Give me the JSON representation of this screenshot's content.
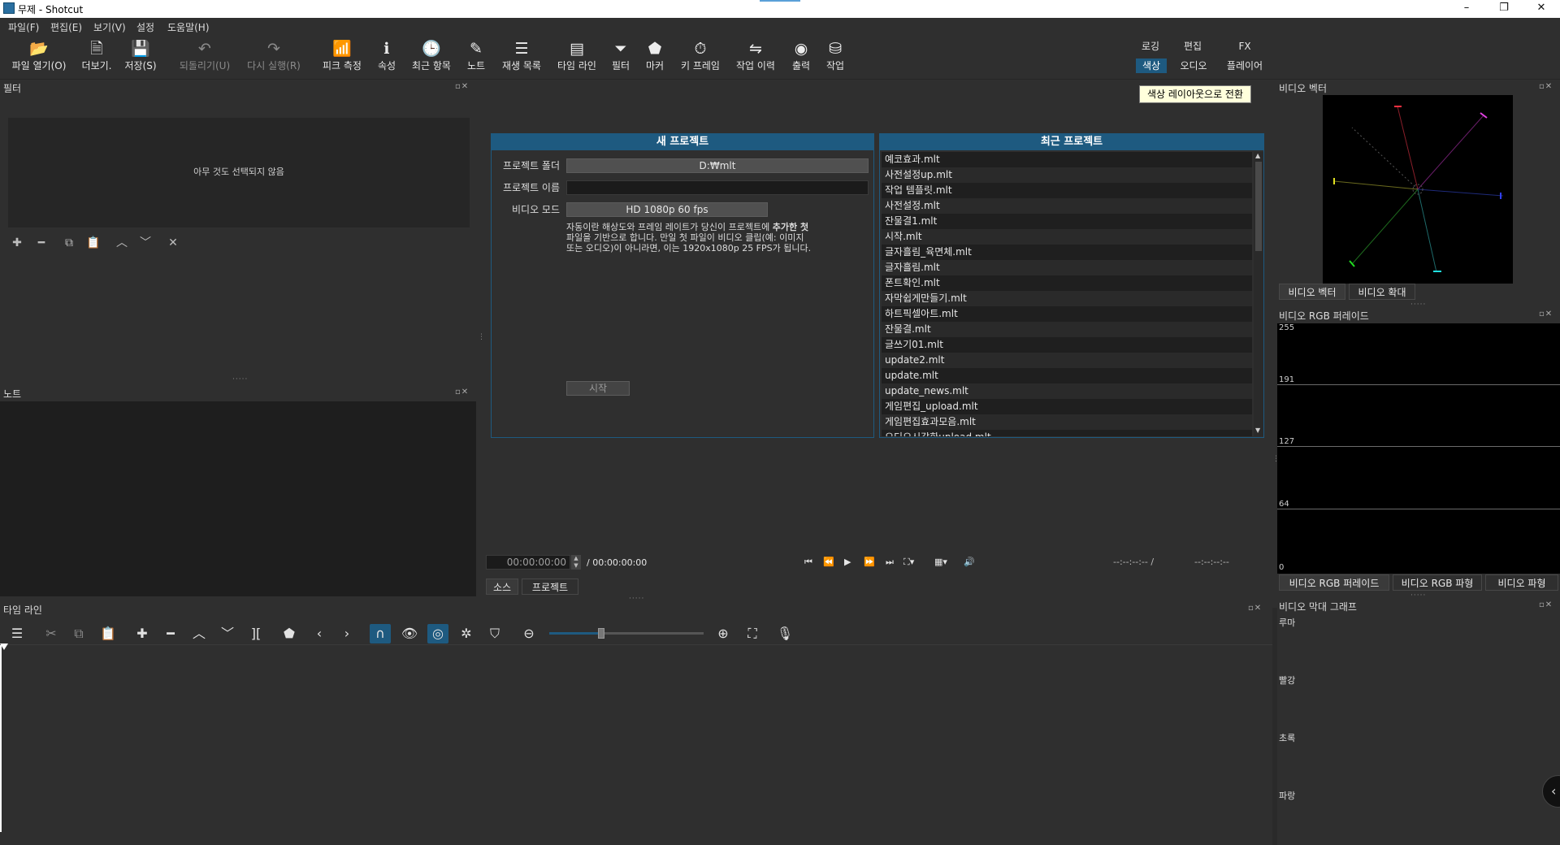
{
  "window": {
    "title": "무제 - Shotcut",
    "minimize": "–",
    "maximize": "❐",
    "close": "✕"
  },
  "menu": [
    "파일(F)",
    "편집(E)",
    "보기(V)",
    "설정",
    "도움말(H)"
  ],
  "toolbar": [
    {
      "label": "파일 열기(O)",
      "icon": "📂",
      "enabled": true
    },
    {
      "label": "더보기.",
      "icon": "🗎",
      "enabled": true
    },
    {
      "label": "저장(S)",
      "icon": "💾",
      "enabled": true
    },
    {
      "label": "되돌리기(U)",
      "icon": "↶",
      "enabled": false
    },
    {
      "label": "다시 실행(R)",
      "icon": "↷",
      "enabled": false
    },
    {
      "label": "피크 측정",
      "icon": "📶",
      "enabled": true
    },
    {
      "label": "속성",
      "icon": "ℹ",
      "enabled": true
    },
    {
      "label": "최근 항목",
      "icon": "🕒",
      "enabled": true
    },
    {
      "label": "노트",
      "icon": "✎",
      "enabled": true
    },
    {
      "label": "재생 목록",
      "icon": "☰",
      "enabled": true
    },
    {
      "label": "타임 라인",
      "icon": "▤",
      "enabled": true
    },
    {
      "label": "필터",
      "icon": "⏷",
      "enabled": true
    },
    {
      "label": "마커",
      "icon": "⬟",
      "enabled": true
    },
    {
      "label": "키 프레임",
      "icon": "⏱",
      "enabled": true
    },
    {
      "label": "작업 이력",
      "icon": "⇋",
      "enabled": true
    },
    {
      "label": "출력",
      "icon": "◉",
      "enabled": true
    },
    {
      "label": "작업",
      "icon": "⛁",
      "enabled": true
    }
  ],
  "layouts": {
    "logging": "로깅",
    "editing": "편집",
    "fx": "FX",
    "color": "색상",
    "audio": "오디오",
    "player": "플레이어",
    "tooltip": "색상 레이아웃으로 전환"
  },
  "filters": {
    "title": "필터",
    "empty": "아무 것도 선택되지 않음"
  },
  "notes": {
    "title": "노트"
  },
  "new_project": {
    "title": "새 프로젝트",
    "folder_label": "프로젝트 폴더",
    "folder_value": "D:₩mlt",
    "name_label": "프로젝트 이름",
    "name_value": "",
    "mode_label": "비디오 모드",
    "mode_value": "HD 1080p 60 fps",
    "description_1": "자동이란 해상도와 프레임 레이트가 당신이 프로젝트에 ",
    "description_bold": "추가한 첫",
    "description_2": "파일을 기반으로 합니다. 만일 첫 파일이 비디오 클립(예: 이미지",
    "description_3": "또는 오디오)이 아니라면, 이는 1920x1080p 25 FPS가 됩니다.",
    "start": "시작"
  },
  "recent": {
    "title": "최근 프로젝트",
    "items": [
      "예코효과.mlt",
      "사전설정up.mlt",
      "작업 템플릿.mlt",
      "사전설정.mlt",
      "잔물결1.mlt",
      "시작.mlt",
      "글자흘림_육면체.mlt",
      "글자흘림.mlt",
      "폰트확인.mlt",
      "자막쉽게만들기.mlt",
      "하트픽셀아트.mlt",
      "잔물결.mlt",
      "글쓰기01.mlt",
      "update2.mlt",
      "update.mlt",
      "update_news.mlt",
      "게임편집_upload.mlt",
      "게임편집효과모음.mlt",
      "오디오시각화upload.mlt"
    ]
  },
  "player": {
    "timecode": "00:00:00:00",
    "duration": "/ 00:00:00:00",
    "in_point": "--:--:--:-- /",
    "out_point": "--:--:--:--",
    "tab_source": "소스",
    "tab_project": "프로젝트"
  },
  "timeline": {
    "title": "타임 라인"
  },
  "scopes": {
    "vector_title": "비디오 벡터",
    "vector_tabs": [
      "비디오 벡터",
      "비디오 확대"
    ],
    "rgb_parade_title": "비디오 RGB 퍼레이드",
    "parade_levels": [
      "255",
      "191",
      "127",
      "64",
      "0"
    ],
    "rgb_tabs": [
      "비디오 RGB 퍼레이드",
      "비디오 RGB 파형",
      "비디오 파형"
    ],
    "histogram_title": "비디오 막대 그래프",
    "histogram_labels": [
      "루마",
      "빨강",
      "초록",
      "파랑"
    ]
  },
  "colors": {
    "accent": "#1e5a80",
    "bg": "#2f2f2f",
    "panel": "#1e1e1e"
  }
}
